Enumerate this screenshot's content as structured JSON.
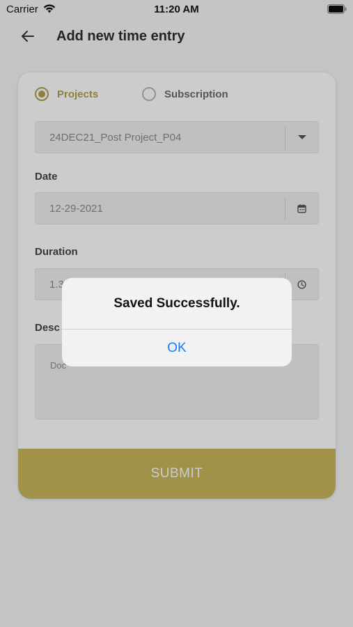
{
  "status_bar": {
    "carrier": "Carrier",
    "time": "11:20 AM",
    "wifi_icon": "wifi-icon",
    "battery_icon": "battery-icon"
  },
  "header": {
    "back_icon": "arrow-left-icon",
    "title": "Add new time entry"
  },
  "form": {
    "type_options": [
      {
        "label": "Projects",
        "selected": true
      },
      {
        "label": "Subscription",
        "selected": false
      }
    ],
    "project": {
      "value": "24DEC21_Post Project_P04",
      "icon": "chevron-down-icon"
    },
    "date": {
      "label": "Date",
      "value": "12-29-2021",
      "icon": "calendar-icon"
    },
    "duration": {
      "label": "Duration",
      "value": "1.3",
      "icon": "clock-icon"
    },
    "description": {
      "label": "Desc",
      "value": "Doc"
    },
    "submit_label": "SUBMIT"
  },
  "alert": {
    "title": "Saved Successfully.",
    "ok_label": "OK"
  },
  "colors": {
    "accent": "#b0a050",
    "submit_bg": "#c9b75c",
    "ios_blue": "#147efb"
  }
}
